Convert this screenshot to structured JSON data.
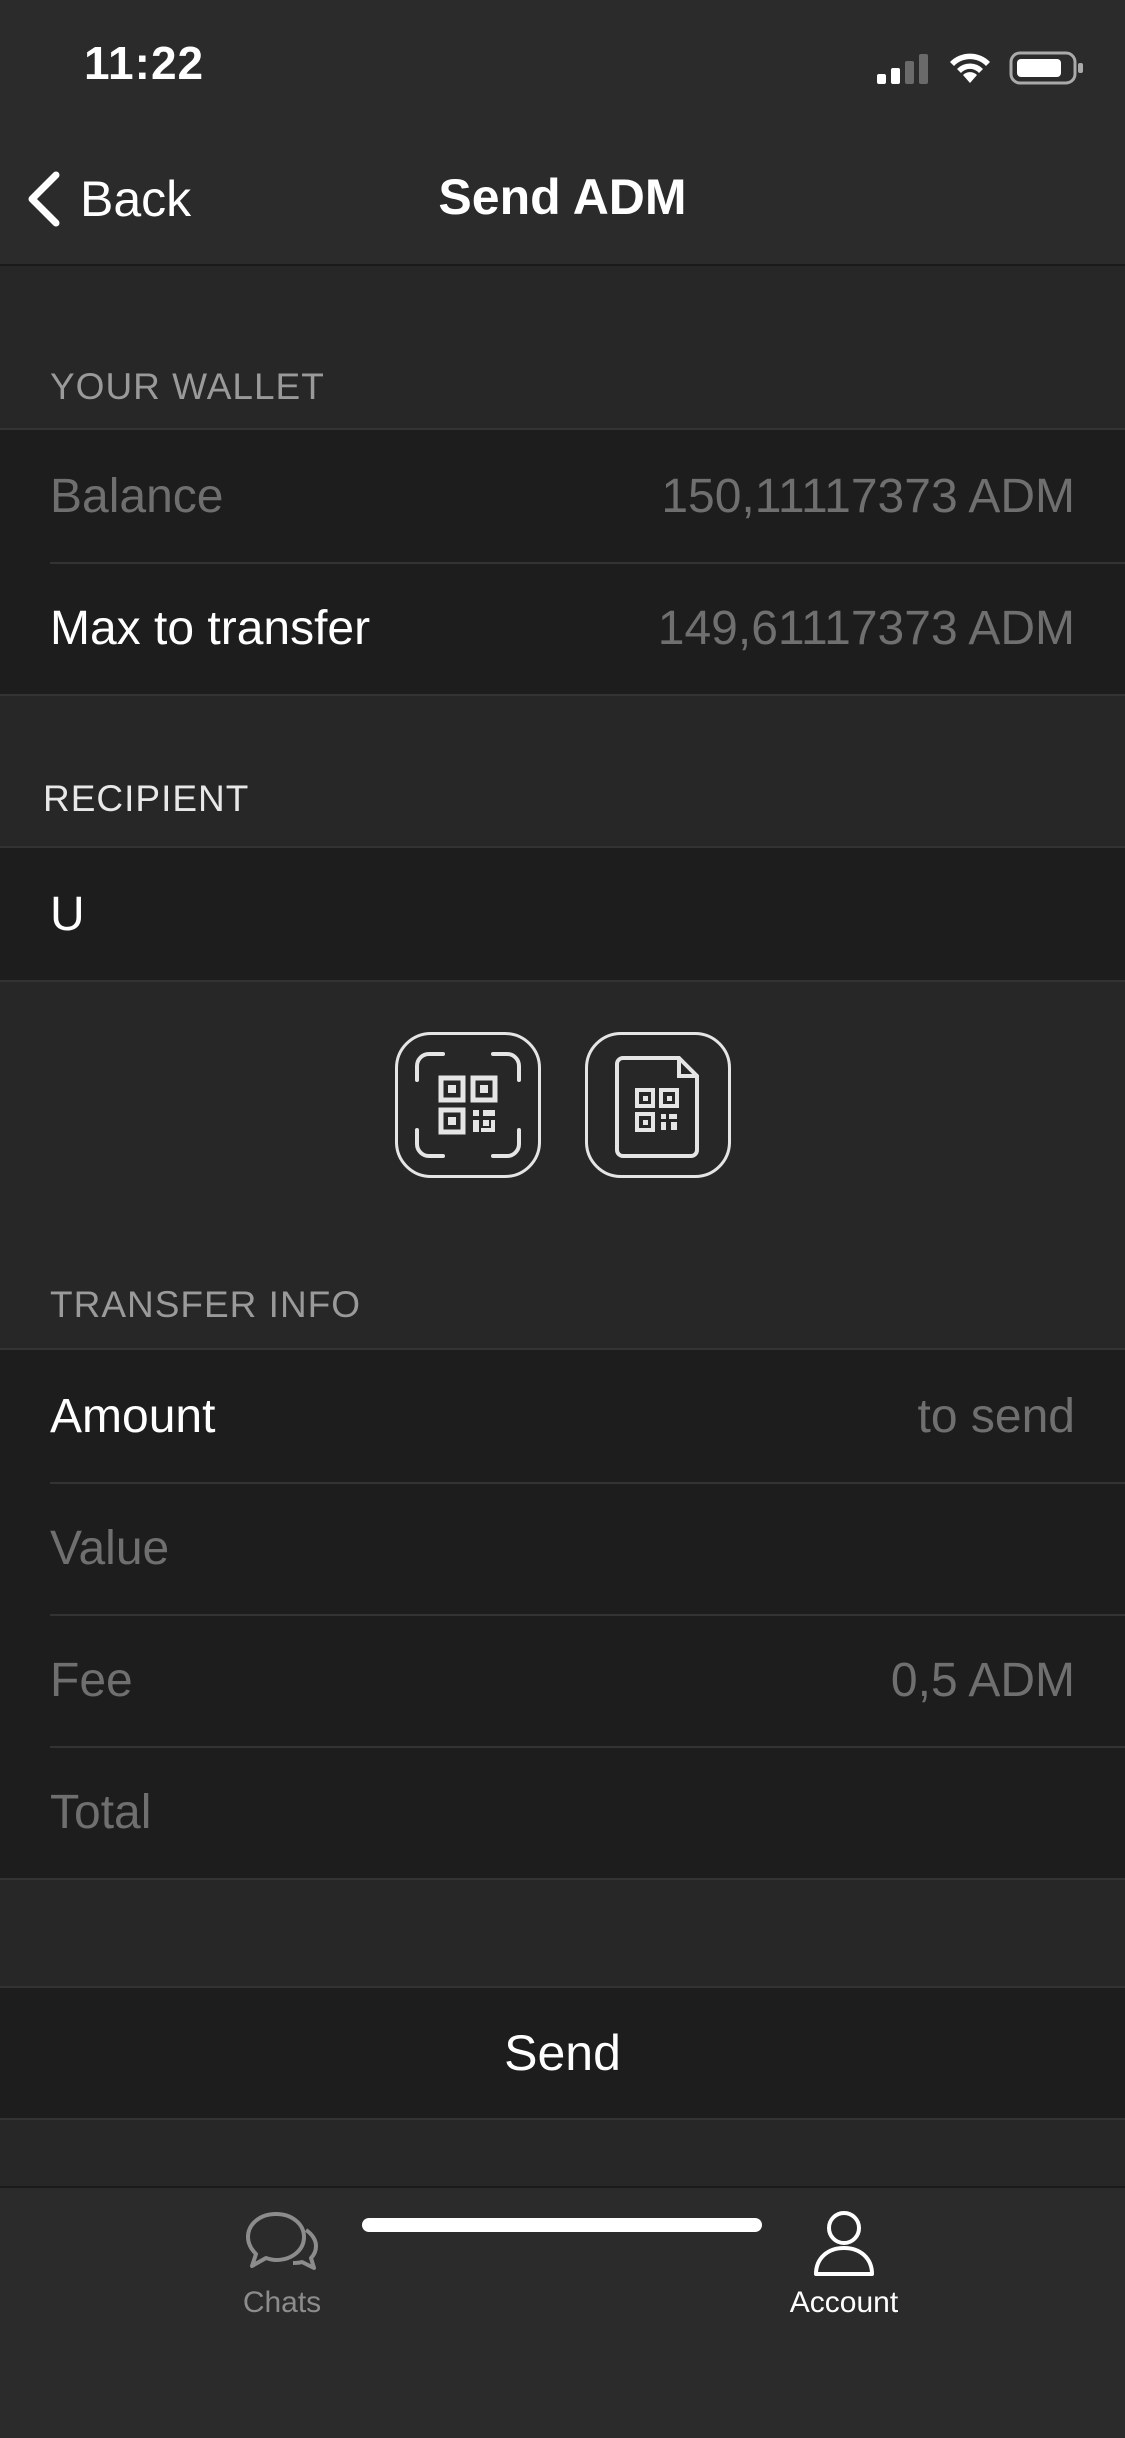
{
  "status_bar": {
    "time": "11:22"
  },
  "nav": {
    "back_label": "Back",
    "title": "Send ADM"
  },
  "wallet": {
    "header": "YOUR WALLET",
    "balance_label": "Balance",
    "balance_value": "150,11117373 ADM",
    "max_label": "Max to transfer",
    "max_value": "149,61117373 ADM"
  },
  "recipient": {
    "header": "RECIPIENT",
    "value": "U"
  },
  "transfer": {
    "header": "TRANSFER INFO",
    "amount_label": "Amount",
    "amount_placeholder": "to send",
    "value_label": "Value",
    "fee_label": "Fee",
    "fee_value": "0,5 ADM",
    "total_label": "Total"
  },
  "send_label": "Send",
  "tabs": [
    {
      "label": "Chats",
      "icon": "chats-icon",
      "active": false
    },
    {
      "label": "Account",
      "icon": "account-icon",
      "active": true
    }
  ]
}
